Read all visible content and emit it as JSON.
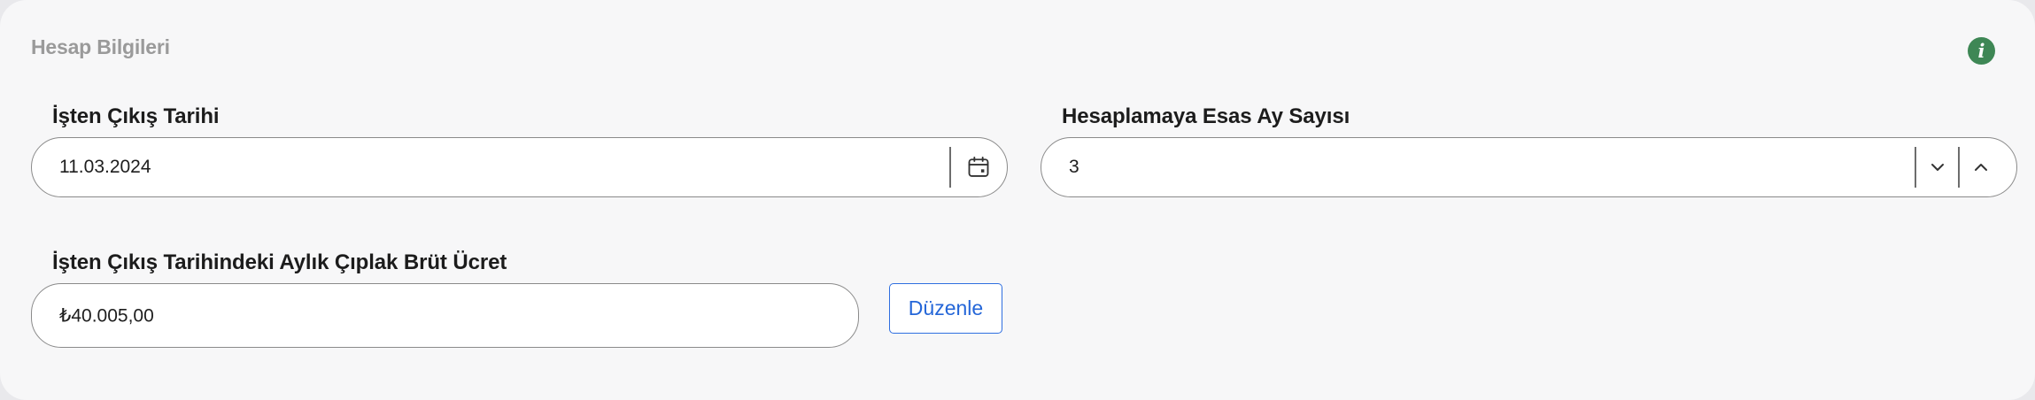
{
  "section": {
    "title": "Hesap Bilgileri",
    "info_icon": "info-icon",
    "info_glyph": "i",
    "info_color": "#3e8755"
  },
  "exit_date": {
    "label": "İşten Çıkış Tarihi",
    "value": "11.03.2024",
    "icon": "calendar-icon"
  },
  "months": {
    "label": "Hesaplamaya Esas Ay Sayısı",
    "value": "3",
    "decrement_icon": "chevron-down-icon",
    "increment_icon": "chevron-up-icon"
  },
  "salary": {
    "label": "İşten Çıkış Tarihindeki Aylık Çıplak Brüt Ücret",
    "value": "₺40.005,00",
    "edit_label": "Düzenle"
  },
  "colors": {
    "accent": "#2466d8",
    "border": "#8a8a8a",
    "card_background": "#f7f7f8"
  }
}
